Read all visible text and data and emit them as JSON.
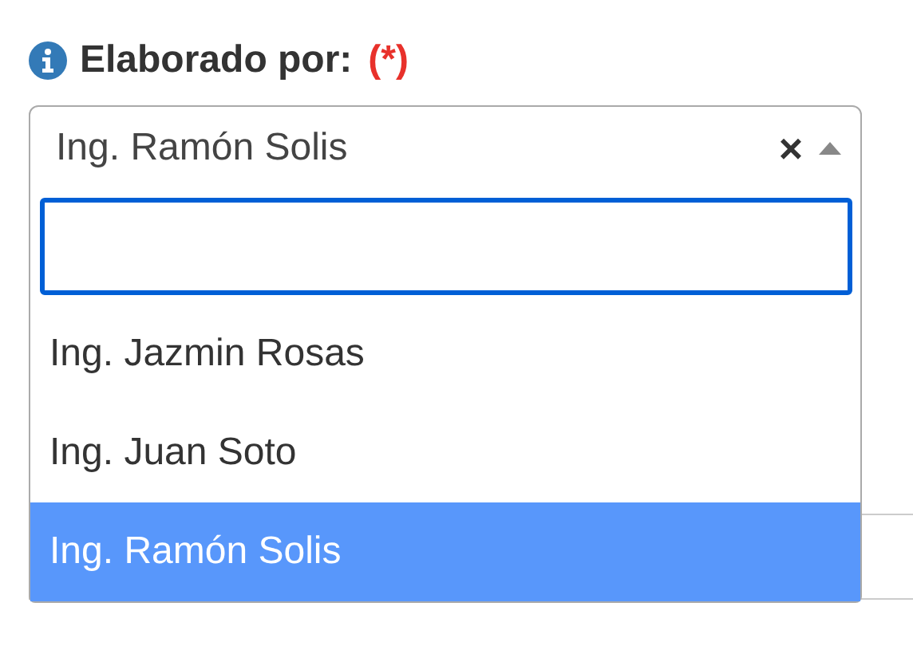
{
  "field": {
    "label": "Elaborado por:",
    "required_mark": "(*)",
    "value": "Ing. Ramón Solis",
    "clear": "×",
    "expanded": true
  },
  "options": [
    {
      "label": "Ing. Jazmin Rosas",
      "selected": false
    },
    {
      "label": "Ing. Juan Soto",
      "selected": false
    },
    {
      "label": "Ing. Ramón Solis",
      "selected": true
    }
  ]
}
